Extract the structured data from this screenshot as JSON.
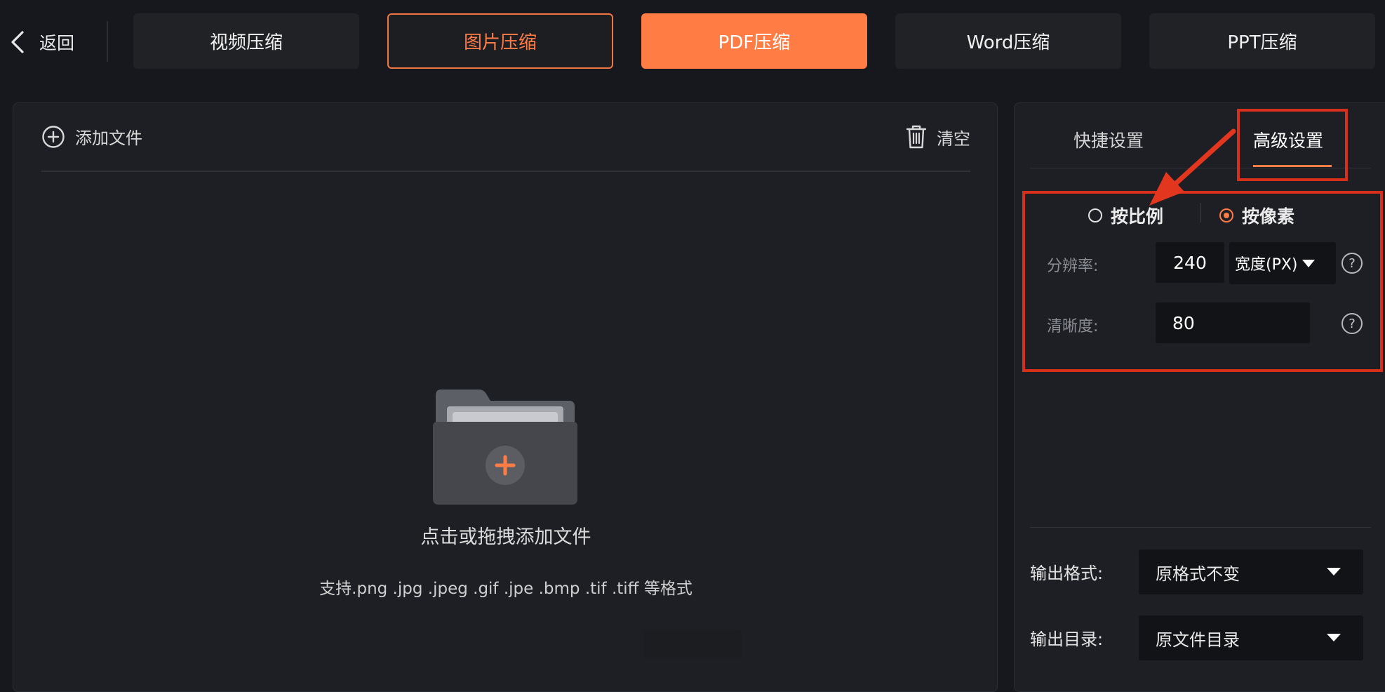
{
  "nav": {
    "back_label": "返回",
    "tabs": [
      {
        "label": "视频压缩",
        "state": "normal"
      },
      {
        "label": "图片压缩",
        "state": "outlined"
      },
      {
        "label": "PDF压缩",
        "state": "active"
      },
      {
        "label": "Word压缩",
        "state": "normal"
      },
      {
        "label": "PPT压缩",
        "state": "normal"
      }
    ]
  },
  "file_panel": {
    "add_file_label": "添加文件",
    "clear_label": "清空",
    "drop_title": "点击或拖拽添加文件",
    "drop_hint": "支持.png .jpg .jpeg .gif .jpe .bmp .tif .tiff 等格式"
  },
  "settings": {
    "tabs": {
      "quick": "快捷设置",
      "advanced": "高级设置",
      "selected": "advanced"
    },
    "mode": {
      "ratio_label": "按比例",
      "pixel_label": "按像素",
      "selected": "pixel"
    },
    "resolution": {
      "label": "分辨率:",
      "value": "240",
      "unit": "宽度(PX)"
    },
    "clarity": {
      "label": "清晰度:",
      "value": "80"
    },
    "help_glyph": "?",
    "output_format": {
      "label": "输出格式:",
      "value": "原格式不变"
    },
    "output_dir": {
      "label": "输出目录:",
      "value": "原文件目录"
    }
  },
  "colors": {
    "accent": "#ff7d45",
    "highlight_box": "#d6301d",
    "background": "#16181d",
    "panel": "#1d1f24"
  }
}
